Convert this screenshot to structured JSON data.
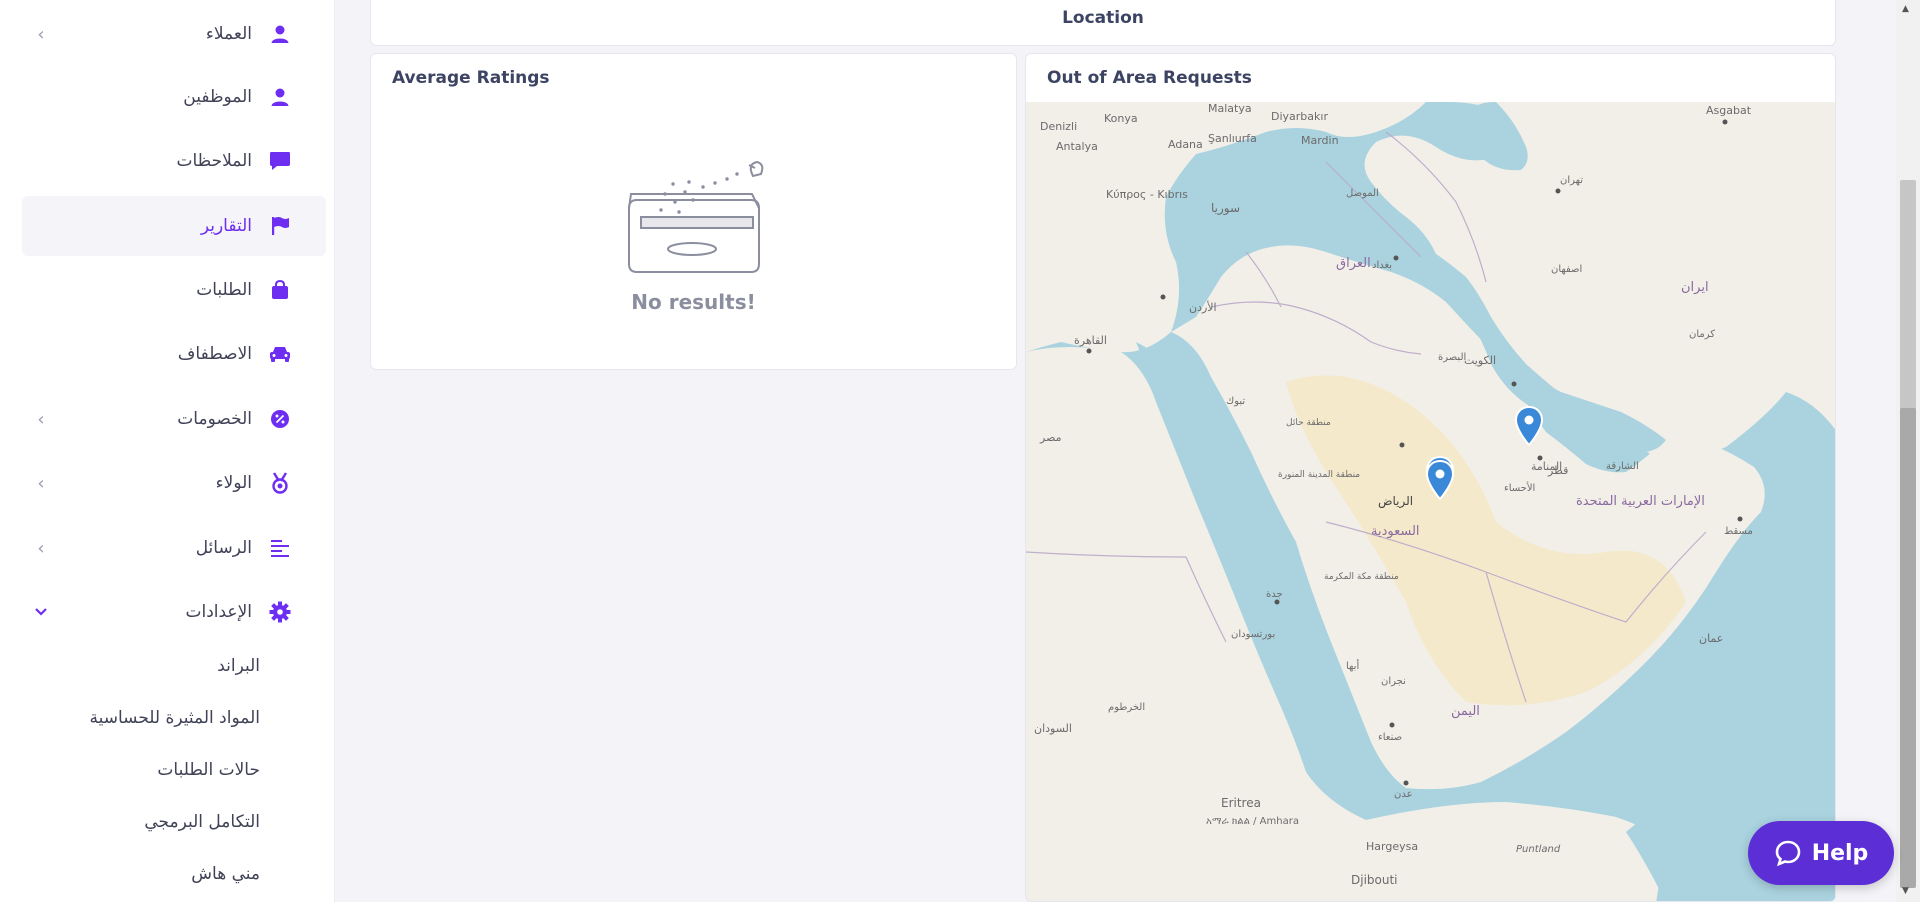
{
  "sidebar": {
    "items": [
      {
        "label": "العملاء",
        "icon": "user-icon",
        "has_chevron": true
      },
      {
        "label": "الموظفين",
        "icon": "user-icon",
        "has_chevron": false
      },
      {
        "label": "الملاحظات",
        "icon": "chat-bubble-icon",
        "has_chevron": false
      },
      {
        "label": "التقارير",
        "icon": "flag-icon",
        "has_chevron": false,
        "active": true
      },
      {
        "label": "الطلبات",
        "icon": "shopping-bag-icon",
        "has_chevron": false
      },
      {
        "label": "الاصطفاف",
        "icon": "car-icon",
        "has_chevron": false
      },
      {
        "label": "الخصومات",
        "icon": "discount-badge-icon",
        "has_chevron": true
      },
      {
        "label": "الولاء",
        "icon": "medal-icon",
        "has_chevron": true
      },
      {
        "label": "الرسائل",
        "icon": "text-align-icon",
        "has_chevron": true
      },
      {
        "label": "الإعدادات",
        "icon": "gear-icon",
        "has_chevron": true,
        "expanded": true
      }
    ],
    "settings_subitems": [
      {
        "label": "البراند"
      },
      {
        "label": "المواد المثيرة للحساسية"
      },
      {
        "label": "حالات الطلبات"
      },
      {
        "label": "التكامل البرمجي"
      },
      {
        "label": "مني هاش"
      }
    ]
  },
  "main": {
    "location_card": {
      "label": "Location"
    },
    "ratings_card": {
      "title": "Average Ratings",
      "empty_text": "No results!"
    },
    "map_card": {
      "title": "Out of Area Requests",
      "markers": [
        {
          "place": "الرياض"
        },
        {
          "place": "المنامة"
        }
      ],
      "place_labels": {
        "riyadh": "الرياض",
        "saudi": "السعودية",
        "manama": "المنامة",
        "uae": "الإمارات العربية المتحدة",
        "iraq": "العراق",
        "iran": "ایران",
        "kuwait": "الكويت",
        "jordan": "الأردن",
        "syria": "سوريا",
        "yemen": "اليمن",
        "oman": "عمان",
        "qatar": "قطر",
        "eritrea": "Eritrea",
        "djibouti": "Djibouti",
        "cyprus": "Κύπρος - Kıbrıs",
        "cairo": "القاهرة",
        "baghdad": "بغداد",
        "tehran": "تهران",
        "muscat": "مسقط",
        "sanaa": "صنعاء",
        "aden": "عدن",
        "jeddah": "جدة",
        "mecca": "منطقة مكة المكرمة",
        "tabuk": "تبوك",
        "medina": "منطقة المدينة المنورة",
        "hail": "منطقة حائل",
        "ahsa": "الأحساء",
        "dubai": "الشارقة",
        "ashgabat": "Asgabat",
        "konya": "Konya",
        "antalya": "Antalya",
        "adana": "Adana",
        "malatya": "Malatya",
        "diyarbakir": "Diyarbakır",
        "sanliurfa": "Şanlıurfa",
        "mardin": "Mardin",
        "denizli": "Denizli",
        "hargeysa": "Hargeysa",
        "amhara": "አማራ ክልል / Amhara",
        "puntland": "Puntland",
        "sudan": "السودان",
        "khartoum": "الخرطوم",
        "egypt": "مصر",
        "basra": "البصرة",
        "port_sudan": "بورتسودان",
        "mosul": "الموصل",
        "kerman": "کرمان",
        "isfahan": "اصفهان",
        "najran": "نجران",
        "abha": "أبها"
      }
    }
  },
  "help_button": {
    "label": "Help"
  },
  "colors": {
    "accent": "#6d2ef2",
    "help_bg": "#5b2ed6",
    "sea": "#aad3df",
    "land": "#f2efe9",
    "desert": "#f5e7c4"
  }
}
